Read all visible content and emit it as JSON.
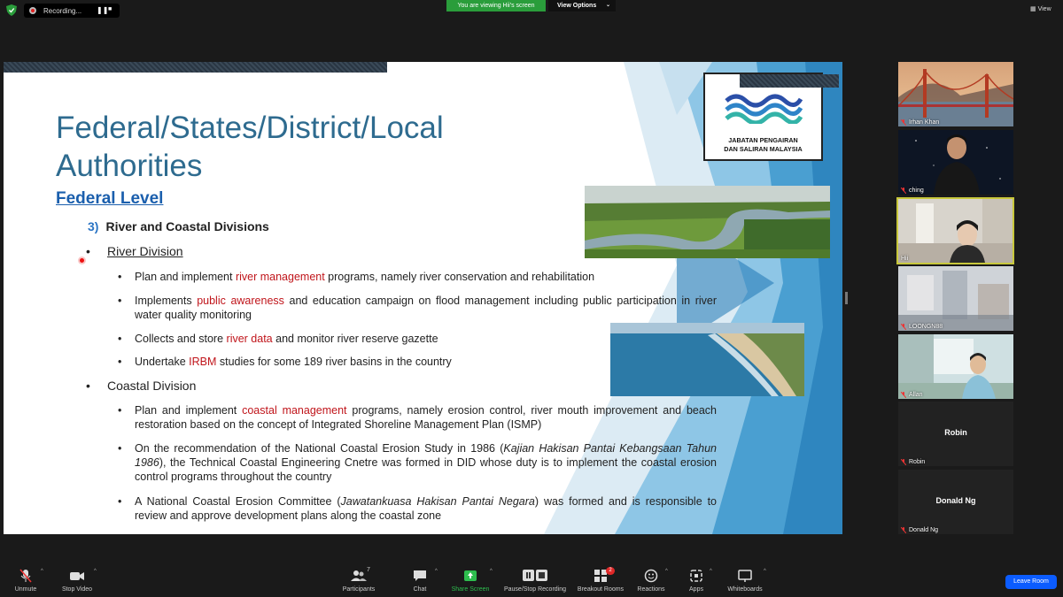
{
  "topbar": {
    "recording_label": "Recording...",
    "viewing_banner": "You are viewing Hii's screen",
    "view_options_label": "View Options",
    "view_label": "View"
  },
  "slide": {
    "title": "Federal/States/District/Local Authorities",
    "federal_level": "Federal Level",
    "section_number": "3)",
    "section_title": "River and Coastal Divisions",
    "river_division": "River Division",
    "river_bullets": [
      {
        "pre": "Plan and implement ",
        "hl": "river management",
        "post": " programs, namely river conservation and rehabilitation"
      },
      {
        "pre": "Implements ",
        "hl": "public awareness",
        "post": " and education campaign on flood management including public participation in river water quality monitoring"
      },
      {
        "pre": "Collects and store ",
        "hl": "river data",
        "post": " and monitor river reserve gazette"
      },
      {
        "pre": "Undertake ",
        "hl": "IRBM",
        "post": " studies for some 189 river basins in the country"
      }
    ],
    "coastal_division": "Coastal Division",
    "coastal_bullets": [
      {
        "pre": "Plan and implement ",
        "hl": "coastal management",
        "post": " programs, namely erosion control, river mouth improvement and beach restoration based on the concept of Integrated Shoreline Management Plan (ISMP)"
      },
      {
        "pre": "On the recommendation of the National Coastal Erosion Study in 1986 (",
        "it": "Kajian Hakisan Pantai Kebangsaan Tahun 1986",
        "post": "), the Technical Coastal Engineering Cnetre was formed in DID whose duty is to implement the coastal erosion control programs throughout the country"
      },
      {
        "pre": "A National Coastal Erosion Committee (",
        "it": "Jawatankuasa Hakisan Pantai Negara",
        "post": ") was formed and is responsible to review and approve development plans along the coastal zone"
      }
    ],
    "logo_line1": "JABATAN PENGAIRAN",
    "logo_line2": "DAN SALIRAN MALAYSIA"
  },
  "participants": [
    {
      "name": "Irhan Khan",
      "muted": true
    },
    {
      "name": "ching",
      "muted": true
    },
    {
      "name": "Hii",
      "muted": false,
      "active": true
    },
    {
      "name": "LOONGN88",
      "muted": true
    },
    {
      "name": "Allan",
      "muted": true
    },
    {
      "name": "Robin",
      "muted": true,
      "center": "Robin"
    },
    {
      "name": "Donald Ng",
      "muted": true,
      "center": "Donald Ng"
    }
  ],
  "toolbar": {
    "unmute": "Unmute",
    "stop_video": "Stop Video",
    "participants": "Participants",
    "participants_count": "7",
    "chat": "Chat",
    "share_screen": "Share Screen",
    "pause_recording": "Pause/Stop Recording",
    "breakout_rooms": "Breakout Rooms",
    "breakout_badge": "2",
    "reactions": "Reactions",
    "apps": "Apps",
    "whiteboards": "Whiteboards",
    "leave": "Leave Room"
  },
  "colors": {
    "accent_green": "#2a9d3b",
    "leave_blue": "#0b5cff",
    "title_blue": "#2e6b8f",
    "highlight_red": "#c0151b",
    "active_speaker": "#c8c83c"
  }
}
